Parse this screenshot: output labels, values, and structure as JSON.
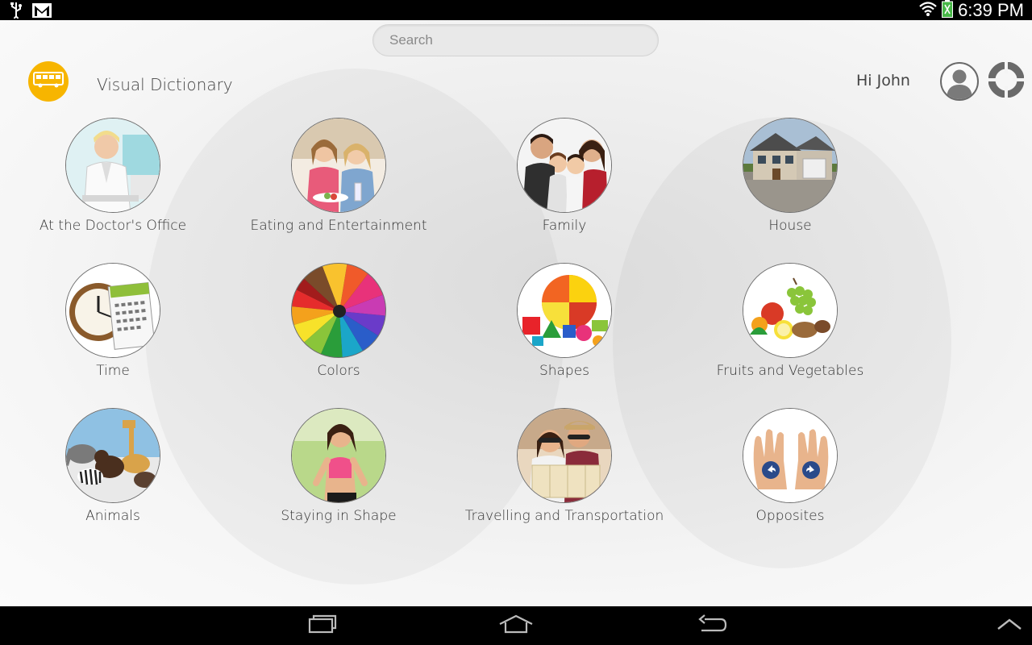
{
  "status": {
    "time": "6:39 PM"
  },
  "search": {
    "placeholder": "Search"
  },
  "header": {
    "title": "Visual Dictionary",
    "greeting": "Hi John"
  },
  "categories": [
    {
      "label": "At the Doctor's Office"
    },
    {
      "label": "Eating and Entertainment"
    },
    {
      "label": "Family"
    },
    {
      "label": "House"
    },
    {
      "label": "Time"
    },
    {
      "label": "Colors"
    },
    {
      "label": "Shapes"
    },
    {
      "label": "Fruits and Vegetables"
    },
    {
      "label": "Animals"
    },
    {
      "label": "Staying in Shape"
    },
    {
      "label": "Travelling and Transportation"
    },
    {
      "label": "Opposites"
    }
  ],
  "colors": {
    "logo": "#f7b500",
    "accent": "#6a6a6a",
    "battery": "#48b848"
  },
  "icons": [
    "usb-icon",
    "gmail-icon",
    "wifi-icon",
    "battery-icon",
    "bus-icon",
    "user-icon",
    "lifebuoy-icon",
    "recent-apps-icon",
    "home-icon",
    "back-icon",
    "chevron-up-icon"
  ]
}
